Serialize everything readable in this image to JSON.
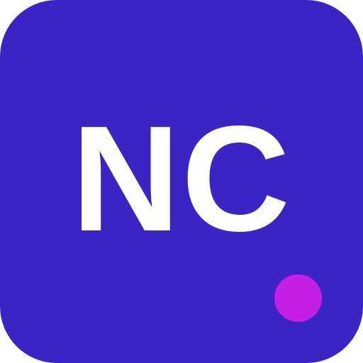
{
  "icon": {
    "monogram": "NC",
    "background_color": "#3b24c4",
    "text_color": "#ffffff",
    "status_dot_color": "#c51fe3"
  }
}
